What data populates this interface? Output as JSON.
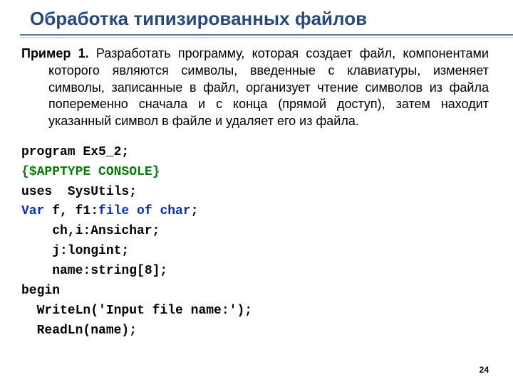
{
  "title": "Обработка типизированных файлов",
  "paragraph": {
    "lead": "Пример 1.",
    "rest": " Разработать программу, которая создает файл, компонентами которого являются символы, введенные с клавиатуры, изменяет символы, записанные в файл, организует чтение символов из файла попеременно сначала и с конца (прямой доступ), затем  находит указанный символ в файле и удаляет его из файла."
  },
  "code": {
    "l1a": "program",
    "l1b": " Ex5_2;",
    "l2": "{$APPTYPE CONSOLE}",
    "l3": "uses  SysUtils;",
    "l4a": "Var",
    "l4b": " f, f1:",
    "l4c": "file of char",
    "l4d": ";",
    "l5": "    ch,i:Ansichar;",
    "l6": "    j:longint;",
    "l7": "    name:string[8];",
    "l8": "begin",
    "l9": "  WriteLn('Input file name:');",
    "l10": "  ReadLn(name);"
  },
  "page_number": "24"
}
